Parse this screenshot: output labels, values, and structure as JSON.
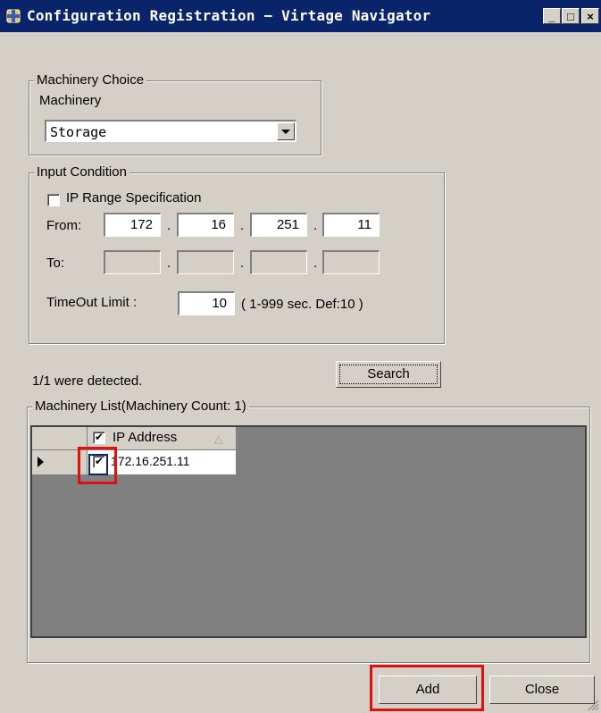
{
  "window": {
    "title": "Configuration Registration − Virtage Navigator",
    "minimize_label": "_",
    "maximize_label": "□",
    "close_label": "×"
  },
  "machinery_choice": {
    "legend": "Machinery Choice",
    "label": "Machinery",
    "selected": "Storage"
  },
  "input_condition": {
    "legend": "Input Condition",
    "ip_range_label": "IP Range Specification",
    "ip_range_checked": false,
    "from_label": "From:",
    "to_label": "To:",
    "from_octets": [
      "172",
      "16",
      "251",
      "11"
    ],
    "to_octets": [
      "",
      "",
      "",
      ""
    ],
    "octet_separator": ".",
    "timeout_label": "TimeOut Limit :",
    "timeout_value": "10",
    "timeout_hint": "( 1-999 sec. Def:10 )"
  },
  "search": {
    "status_text": "1/1 were detected.",
    "button_label": "Search"
  },
  "machinery_list": {
    "legend": "Machinery List(Machinery Count: 1)",
    "column_header": "IP Address",
    "header_checked": true,
    "rows": [
      {
        "ip": "172.16.251.11",
        "checked": true
      }
    ]
  },
  "footer": {
    "add_label": "Add",
    "close_label": "Close"
  },
  "colors": {
    "title_bar": "#0a246a",
    "face": "#d4d0c8",
    "grid_background": "#808080",
    "highlight": "#e01010"
  }
}
